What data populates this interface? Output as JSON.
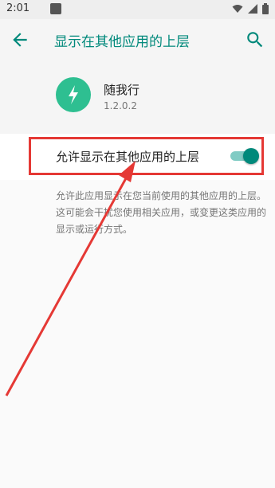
{
  "status_bar": {
    "time": "2:01",
    "icons": [
      "notification-icon",
      "wifi-icon",
      "signal-icon",
      "battery-icon"
    ]
  },
  "app_bar": {
    "title": "显示在其他应用的上层",
    "back_icon": "arrow-back-icon",
    "search_icon": "search-icon"
  },
  "app_info": {
    "name": "随我行",
    "version": "1.2.0.2",
    "icon": "app-logo-icon"
  },
  "setting": {
    "label": "允许显示在其他应用的上层",
    "enabled": true
  },
  "description": "允许此应用显示在您当前使用的其他应用的上层。这可能会干扰您使用相关应用，或变更这类应用的显示或运行方式。",
  "annotations": {
    "highlight_color": "#e53935"
  },
  "colors": {
    "accent": "#00897b",
    "toggle_track": "#80cbc4",
    "app_icon_bg": "#2ebf91"
  }
}
